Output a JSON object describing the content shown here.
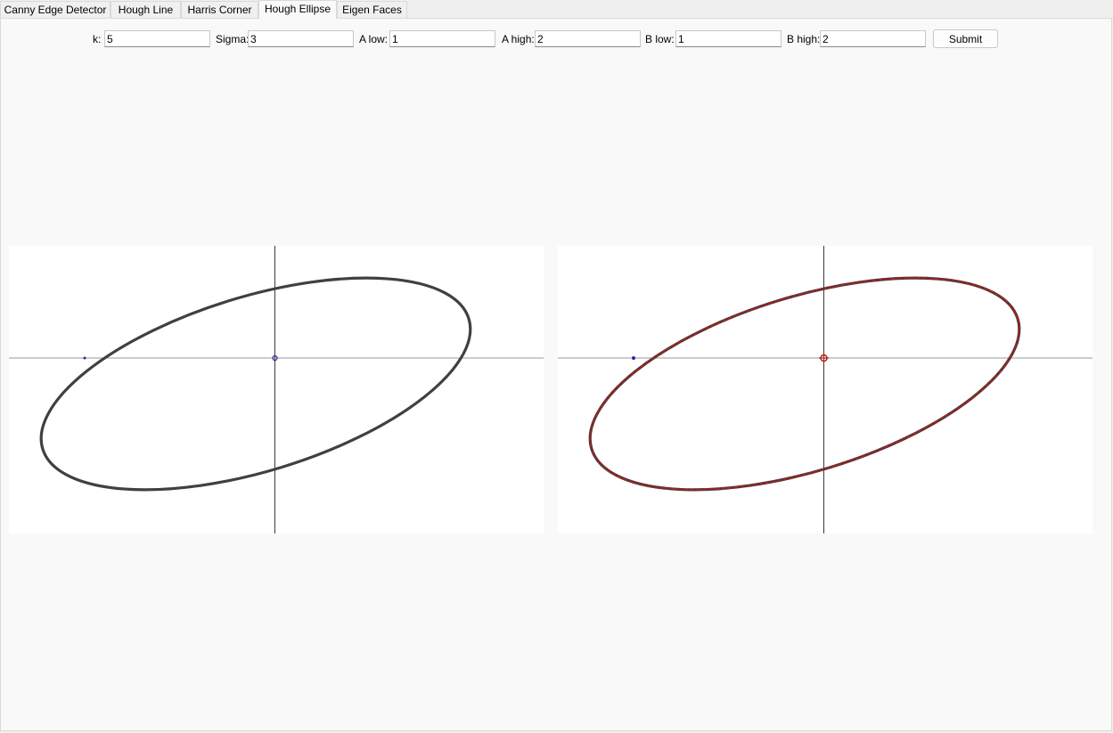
{
  "tabs": [
    {
      "label": "Canny Edge Detector",
      "active": false
    },
    {
      "label": "Hough Line",
      "active": false
    },
    {
      "label": "Harris Corner",
      "active": false
    },
    {
      "label": "Hough Ellipse",
      "active": true
    },
    {
      "label": "Eigen Faces",
      "active": false
    }
  ],
  "form": {
    "k": {
      "label": "k:",
      "value": "5"
    },
    "sigma": {
      "label": "Sigma:",
      "value": "3"
    },
    "a_low": {
      "label": "A low:",
      "value": "1"
    },
    "a_high": {
      "label": "A high:",
      "value": "2"
    },
    "b_low": {
      "label": "B low:",
      "value": "1"
    },
    "b_high": {
      "label": "B high:",
      "value": "2"
    },
    "submit_label": "Submit"
  },
  "plots": {
    "input": {
      "curve_color": "#404040",
      "marker_color": "#2a2aa8",
      "axis_color": "#9a9a9a"
    },
    "output": {
      "curve_color": "#4a3a3a",
      "detected_color": "#b01f1f",
      "marker_color": "#2a2aa8",
      "axis_color": "#9a9a9a"
    }
  }
}
